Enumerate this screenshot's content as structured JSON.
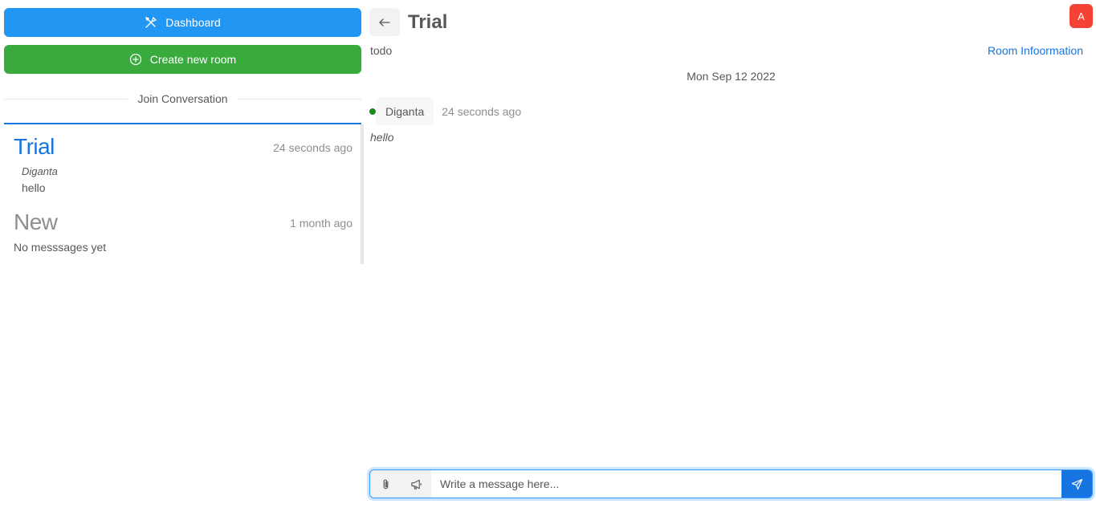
{
  "sidebar": {
    "dashboard_label": "Dashboard",
    "create_room_label": "Create new room",
    "divider_label": "Join Conversation",
    "rooms": [
      {
        "name": "Trial",
        "time": "24 seconds ago",
        "last_author": "Diganta",
        "last_message": "hello"
      },
      {
        "name": "New",
        "time": "1 month ago",
        "last_message": "No messsages yet"
      }
    ]
  },
  "chat": {
    "title": "Trial",
    "description": "todo",
    "room_info_label": "Room Infoormation",
    "avatar_letter": "A",
    "date": "Mon Sep 12 2022",
    "messages": [
      {
        "author": "Diganta",
        "time": "24 seconds ago",
        "text": "hello"
      }
    ],
    "input_placeholder": "Write a message here..."
  },
  "colors": {
    "primary": "#2196f3",
    "success": "#38ab3c",
    "link": "#1675e0",
    "avatar": "#f44336",
    "online": "#1b8a1e"
  },
  "icons": [
    "tools-icon",
    "plus-circle-icon",
    "arrow-left-icon",
    "paperclip-icon",
    "megaphone-icon",
    "send-icon"
  ]
}
